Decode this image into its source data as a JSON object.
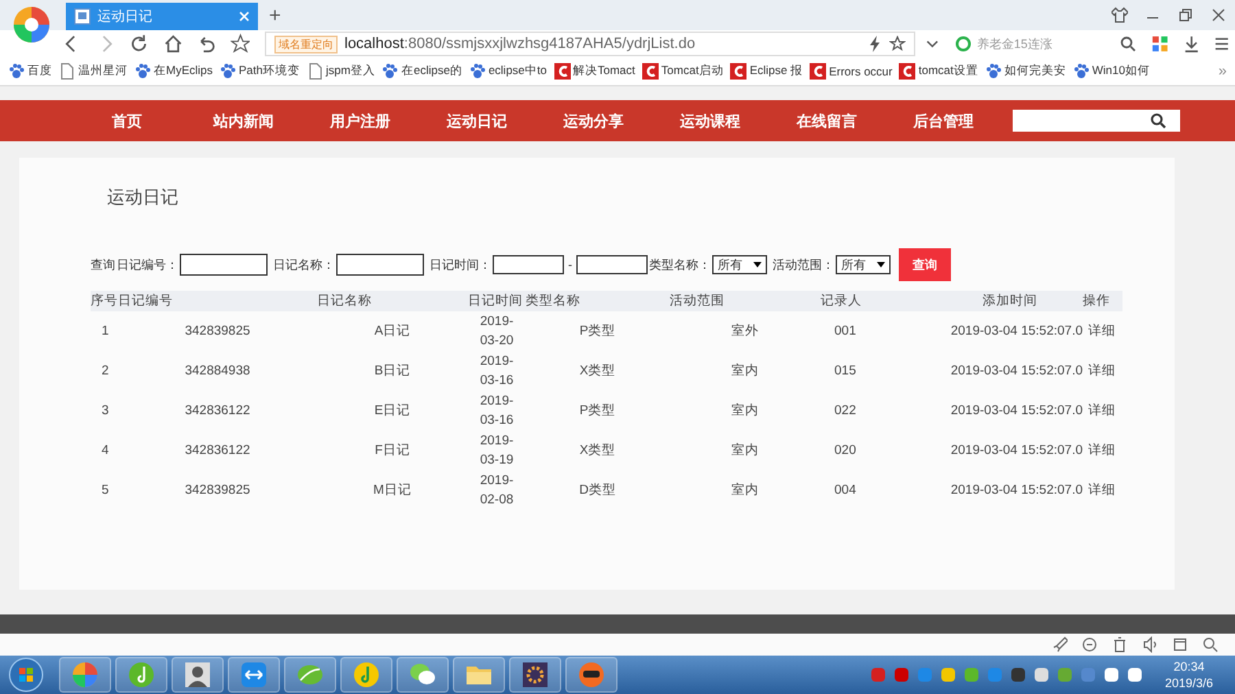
{
  "browser": {
    "tab_title": "运动日记",
    "new_tab": "+",
    "url_badge": "域名重定向",
    "url_host": "localhost",
    "url_rest": ":8080/ssmjsxxjlwzhsg4187AHA5/ydrjList.do",
    "search_placeholder": "养老金15连涨",
    "bookmarks": [
      {
        "kind": "paw",
        "label": "百度"
      },
      {
        "kind": "page",
        "label": "温州星河"
      },
      {
        "kind": "paw",
        "label": "在MyEclips"
      },
      {
        "kind": "paw",
        "label": "Path环境变"
      },
      {
        "kind": "page",
        "label": "jspm登入"
      },
      {
        "kind": "paw",
        "label": "在eclipse的"
      },
      {
        "kind": "paw",
        "label": "eclipse中to"
      },
      {
        "kind": "c",
        "label": "解决Tomact"
      },
      {
        "kind": "c",
        "label": "Tomcat启动"
      },
      {
        "kind": "c",
        "label": "Eclipse 报"
      },
      {
        "kind": "c",
        "label": "Errors occur"
      },
      {
        "kind": "c",
        "label": "tomcat设置"
      },
      {
        "kind": "paw",
        "label": "如何完美安"
      },
      {
        "kind": "paw",
        "label": "Win10如何"
      }
    ],
    "more": "»"
  },
  "nav": {
    "items": [
      "首页",
      "站内新闻",
      "用户注册",
      "运动日记",
      "运动分享",
      "运动课程",
      "在线留言",
      "后台管理"
    ]
  },
  "page": {
    "title": "运动日记",
    "filter": {
      "label": "查询",
      "fields": [
        {
          "kind": "text",
          "label": "日记编号："
        },
        {
          "kind": "text",
          "label": "日记名称："
        },
        {
          "kind": "range",
          "label": "日记时间：",
          "separator": "-"
        },
        {
          "kind": "select",
          "label": "类型名称：",
          "value": "所有"
        },
        {
          "kind": "select",
          "label": "活动范围：",
          "value": "所有"
        }
      ],
      "button": "查询"
    },
    "table": {
      "columns": [
        "序号",
        "日记编号",
        "日记名称",
        "日记时间",
        "类型名称",
        "活动范围",
        "记录人",
        "添加时间",
        "操作"
      ],
      "rows": [
        [
          "1",
          "342839825",
          "A日记",
          "2019-03-20",
          "P类型",
          "室外",
          "001",
          "2019-03-04 15:52:07.0",
          "详细"
        ],
        [
          "2",
          "342884938",
          "B日记",
          "2019-03-16",
          "X类型",
          "室内",
          "015",
          "2019-03-04 15:52:07.0",
          "详细"
        ],
        [
          "3",
          "342836122",
          "E日记",
          "2019-03-16",
          "P类型",
          "室内",
          "022",
          "2019-03-04 15:52:07.0",
          "详细"
        ],
        [
          "4",
          "342836122",
          "F日记",
          "2019-03-19",
          "X类型",
          "室内",
          "020",
          "2019-03-04 15:52:07.0",
          "详细"
        ],
        [
          "5",
          "342839825",
          "M日记",
          "2019-02-08",
          "D类型",
          "室内",
          "004",
          "2019-03-04 15:52:07.0",
          "详细"
        ]
      ]
    }
  },
  "taskbar": {
    "time": "20:34",
    "date": "2019/3/6"
  }
}
